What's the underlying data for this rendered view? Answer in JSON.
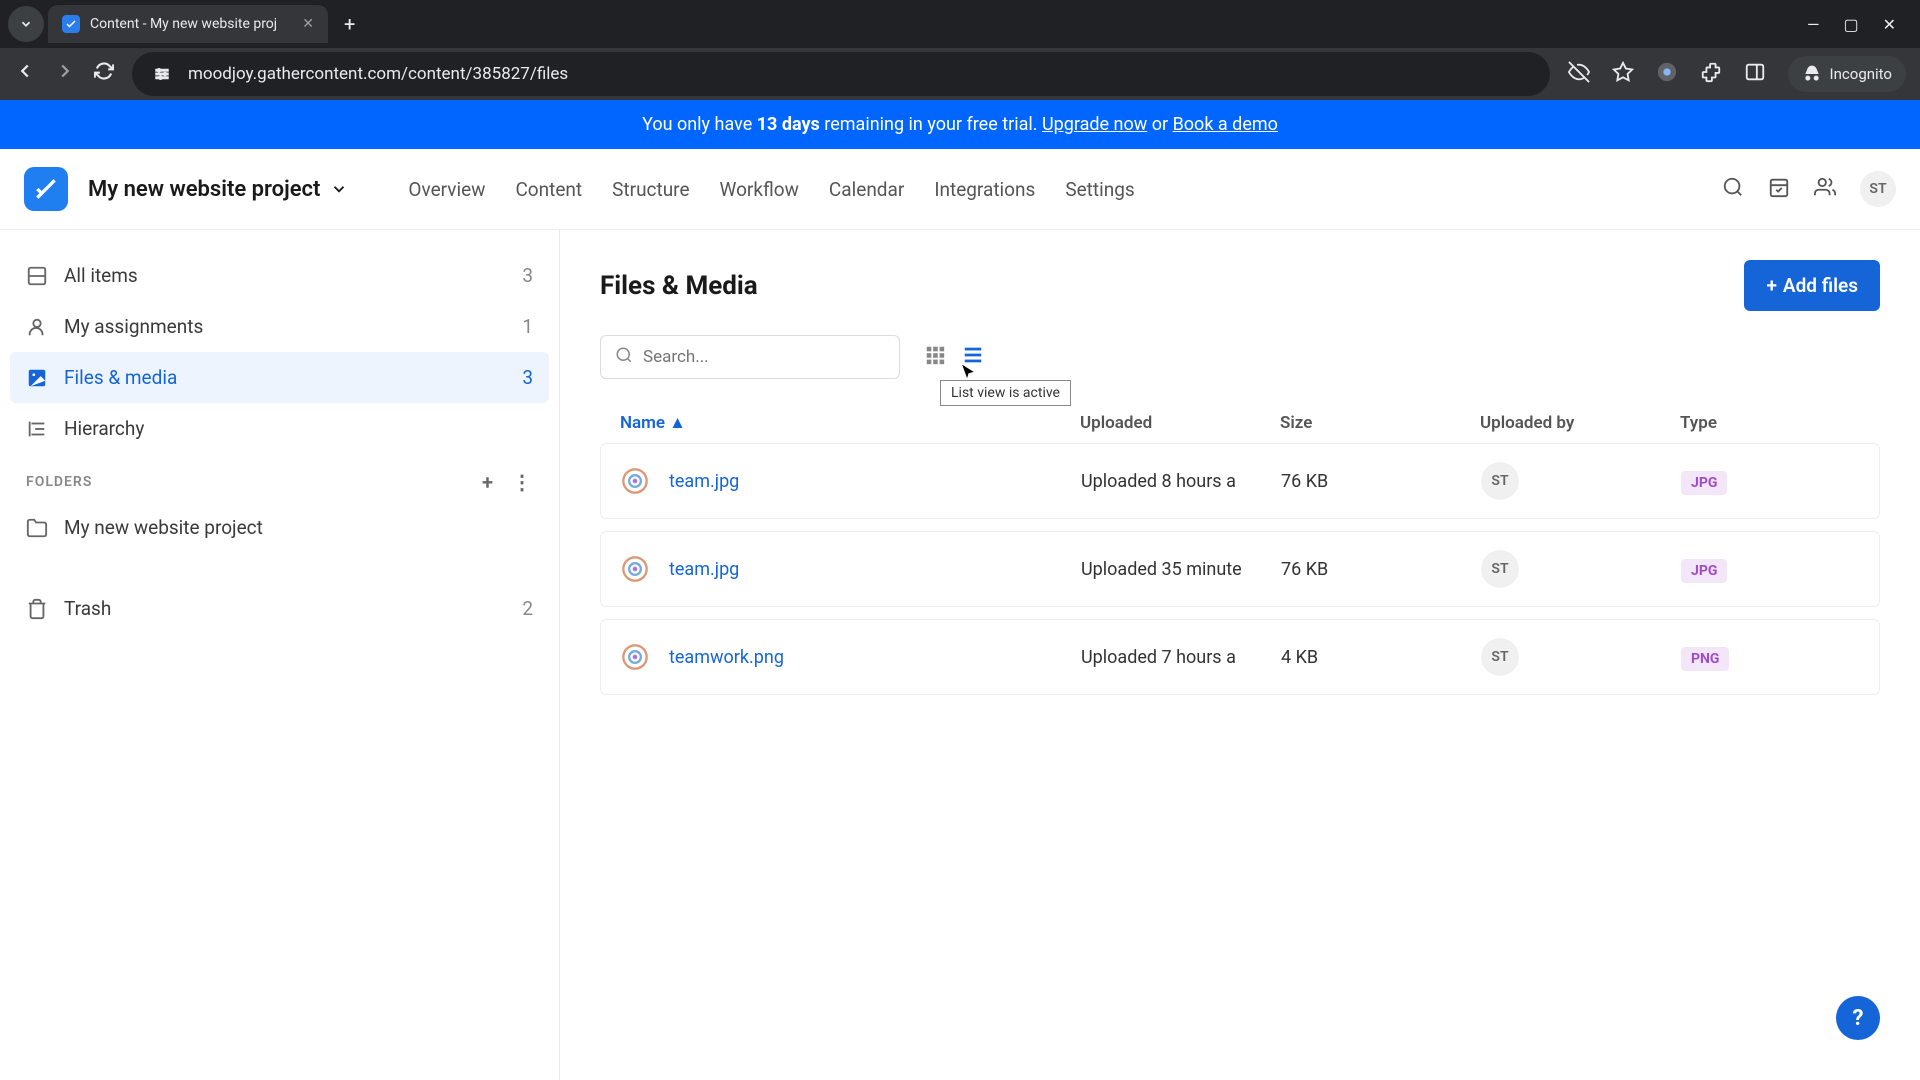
{
  "browser": {
    "tab_title": "Content - My new website proj",
    "url": "moodjoy.gathercontent.com/content/385827/files",
    "incognito_label": "Incognito"
  },
  "trial_banner": {
    "prefix": "You only have ",
    "days": "13 days",
    "middle": " remaining in your free trial. ",
    "upgrade": "Upgrade now",
    "or": " or ",
    "demo": "Book a demo"
  },
  "topbar": {
    "project_name": "My new website project",
    "tabs": [
      "Overview",
      "Content",
      "Structure",
      "Workflow",
      "Calendar",
      "Integrations",
      "Settings"
    ],
    "avatar": "ST"
  },
  "sidebar": {
    "items": [
      {
        "label": "All items",
        "count": "3"
      },
      {
        "label": "My assignments",
        "count": "1"
      },
      {
        "label": "Files & media",
        "count": "3"
      },
      {
        "label": "Hierarchy",
        "count": ""
      }
    ],
    "folders_label": "FOLDERS",
    "folder_name": "My new website project",
    "trash_label": "Trash",
    "trash_count": "2"
  },
  "content": {
    "title": "Files & Media",
    "add_button": "Add files",
    "search_placeholder": "Search...",
    "tooltip": "List view is active",
    "columns": {
      "name": "Name",
      "uploaded": "Uploaded",
      "size": "Size",
      "uploaded_by": "Uploaded by",
      "type": "Type"
    },
    "rows": [
      {
        "name": "team.jpg",
        "uploaded": "Uploaded 8 hours a",
        "size": "76 KB",
        "uploader": "ST",
        "type": "JPG",
        "type_class": "type-jpg"
      },
      {
        "name": "team.jpg",
        "uploaded": "Uploaded 35 minute",
        "size": "76 KB",
        "uploader": "ST",
        "type": "JPG",
        "type_class": "type-jpg"
      },
      {
        "name": "teamwork.png",
        "uploaded": "Uploaded 7 hours a",
        "size": "4 KB",
        "uploader": "ST",
        "type": "PNG",
        "type_class": "type-png"
      }
    ]
  },
  "help": "?"
}
